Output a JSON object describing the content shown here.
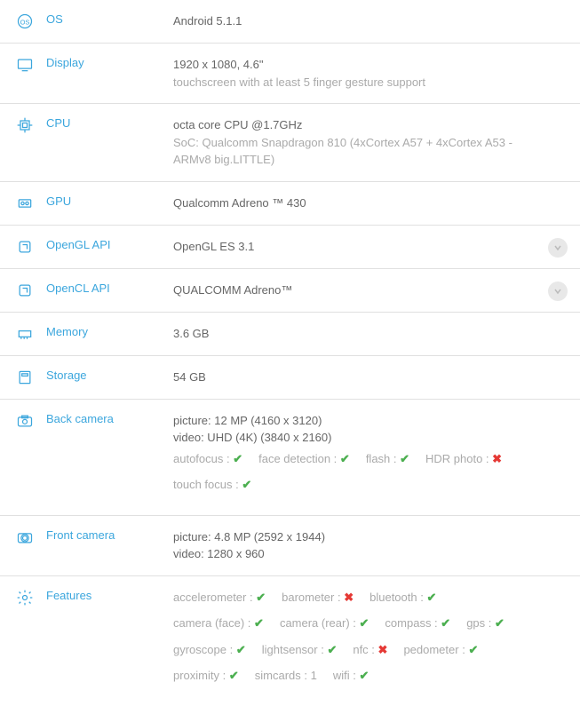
{
  "rows": {
    "os": {
      "label": "OS",
      "value": "Android 5.1.1"
    },
    "display": {
      "label": "Display",
      "value": "1920 x 1080, 4.6\"",
      "sub": "touchscreen with at least 5 finger gesture support"
    },
    "cpu": {
      "label": "CPU",
      "value": "octa core CPU @1.7GHz",
      "sub": "SoC: Qualcomm Snapdragon 810 (4xCortex A57 + 4xCortex A53 - ARMv8 big.LITTLE)"
    },
    "gpu": {
      "label": "GPU",
      "value": "Qualcomm Adreno ™ 430"
    },
    "opengl": {
      "label": "OpenGL API",
      "value": "OpenGL ES 3.1"
    },
    "opencl": {
      "label": "OpenCL API",
      "value": "QUALCOMM Adreno™"
    },
    "memory": {
      "label": "Memory",
      "value": "3.6 GB"
    },
    "storage": {
      "label": "Storage",
      "value": "54 GB"
    },
    "backcam": {
      "label": "Back camera",
      "line1": "picture: 12 MP (4160 x 3120)",
      "line2": "video: UHD (4K) (3840 x 2160)",
      "feats": [
        {
          "name": "autofocus",
          "ok": true
        },
        {
          "name": "face detection",
          "ok": true
        },
        {
          "name": "flash",
          "ok": true
        },
        {
          "name": "HDR photo",
          "ok": false
        }
      ],
      "feats2": [
        {
          "name": "touch focus",
          "ok": true
        }
      ]
    },
    "frontcam": {
      "label": "Front camera",
      "line1": "picture: 4.8 MP (2592 x 1944)",
      "line2": "video: 1280 x 960"
    },
    "features": {
      "label": "Features",
      "group1": [
        {
          "name": "accelerometer",
          "ok": true
        },
        {
          "name": "barometer",
          "ok": false
        },
        {
          "name": "bluetooth",
          "ok": true
        }
      ],
      "group2": [
        {
          "name": "camera (face)",
          "ok": true
        },
        {
          "name": "camera (rear)",
          "ok": true
        },
        {
          "name": "compass",
          "ok": true
        },
        {
          "name": "gps",
          "ok": true
        }
      ],
      "group3": [
        {
          "name": "gyroscope",
          "ok": true
        },
        {
          "name": "lightsensor",
          "ok": true
        },
        {
          "name": "nfc",
          "ok": false
        },
        {
          "name": "pedometer",
          "ok": true
        }
      ],
      "group4": [
        {
          "name": "proximity",
          "ok": true
        },
        {
          "name": "simcards",
          "text": "1"
        },
        {
          "name": "wifi",
          "ok": true
        }
      ]
    }
  }
}
